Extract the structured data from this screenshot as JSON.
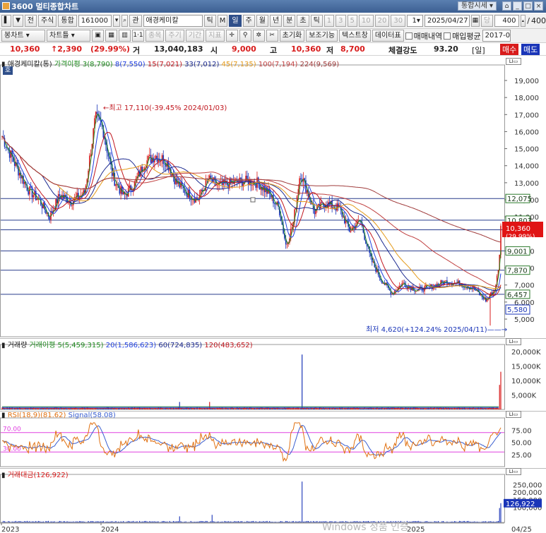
{
  "window": {
    "title": "3600 멀티종합차트",
    "sise_combo": "통합시세"
  },
  "toolbar1": {
    "market": "전",
    "type": "주식",
    "mode": "통합",
    "code": "161000",
    "name_btn": "관",
    "stock_name": "애경케미칼",
    "periods": [
      "틱",
      "일",
      "주",
      "월",
      "년",
      "분",
      "초",
      "틱"
    ],
    "numbers": [
      "1",
      "3",
      "5",
      "10",
      "20",
      "30"
    ],
    "count_select": "1",
    "date": "2025/04/27",
    "dang": "당",
    "count": "400",
    "total": "400"
  },
  "toolbar2": {
    "chart_type": "봉차트",
    "chart_frame": "차트틀",
    "items": [
      "종목",
      "주기",
      "기간",
      "지표"
    ],
    "btns": [
      "초기화",
      "보조기능",
      "텍스트창",
      "데이터표"
    ],
    "checks": [
      "매매내역",
      "매입평균"
    ],
    "date_right": "2017-01"
  },
  "price_row": {
    "price": "10,360",
    "change": "↑2,390",
    "rate": "(29.99%)",
    "vol_label": "거",
    "volume": "13,040,183",
    "open_label": "시",
    "open": "9,000",
    "high_label": "고",
    "high": "10,360",
    "low_label": "저",
    "low": "8,700",
    "strength_label": "체결강도",
    "strength": "93.20",
    "period_tag": "[일]",
    "buy": "매수",
    "sell": "매도"
  },
  "colors": {
    "up": "#d81b1b",
    "down": "#1a35b8",
    "ma3": "#1f8a1f",
    "ma8": "#2040e0",
    "ma15": "#c0161e",
    "ma33": "#1c2a90",
    "ma45": "#e49a1a",
    "ma100": "#c04040",
    "ma224": "#a03c3c",
    "rsi": "#e07010",
    "signal": "#3a5fd0",
    "guide": "#e040e0"
  },
  "main_legend": {
    "name": "애경케미칼(통)",
    "items": [
      {
        "label": "가격이평 3(8,790)",
        "color": "ma3"
      },
      {
        "label": "8(7,550)",
        "color": "ma8"
      },
      {
        "label": "15(7,021)",
        "color": "ma15"
      },
      {
        "label": "33(7,012)",
        "color": "ma33"
      },
      {
        "label": "45(7,135)",
        "color": "ma45"
      },
      {
        "label": "100(7,194)",
        "color": "ma100"
      },
      {
        "label": "224(9,569)",
        "color": "ma224"
      }
    ],
    "corner": "호"
  },
  "annotations": {
    "high": "←최고 17,110(-39.45% 2024/01/03)",
    "low": "최저 4,620(+124.24% 2025/04/11)——→"
  },
  "price_axis": [
    "19,000",
    "18,000",
    "17,000",
    "16,000",
    "15,000",
    "14,000",
    "13,000",
    "12,000",
    "11,000",
    "10,000",
    "9,000",
    "8,000",
    "7,000",
    "6,000",
    "5,000"
  ],
  "price_lines": [
    {
      "label": "12,075",
      "color": "#1a35b8"
    },
    {
      "label": "10,803",
      "color": "#1a35b8"
    },
    {
      "label": "10,238",
      "color": "#1a35b8"
    },
    {
      "label": "9,001",
      "color": "#1a35b8"
    },
    {
      "label": "7,870",
      "color": "#1a35b8"
    },
    {
      "label": "6,457",
      "color": "#1a35b8"
    }
  ],
  "price_badges": {
    "current": "10,360",
    "current_pct": "(29.99%)",
    "low_badge": "5,580"
  },
  "volume_legend": {
    "name": "거래량",
    "items": [
      {
        "label": "거래이평 5(5,459,315)",
        "color": "ma3"
      },
      {
        "label": "20(1,586,623)",
        "color": "ma8"
      },
      {
        "label": "60(724,835)",
        "color": "ma33"
      },
      {
        "label": "120(483,652)",
        "color": "ma15"
      }
    ]
  },
  "volume_axis": [
    "20,000K",
    "15,000K",
    "10,000K",
    "5,000K"
  ],
  "rsi_legend": {
    "items": [
      {
        "label": "RSI(18,9)(81.62)",
        "color": "rsi"
      },
      {
        "label": "Signal(58.08)",
        "color": "signal"
      }
    ],
    "level_high": "70.00",
    "level_low": "30.00"
  },
  "rsi_axis": [
    "75.00",
    "50.00",
    "25.00"
  ],
  "amount_legend": {
    "name": "거래대금(126,922)"
  },
  "amount_axis": [
    "250,000",
    "200,000",
    "150,000",
    "100,000"
  ],
  "amount_badge": "126,922",
  "x_axis": [
    "2023",
    "2024",
    "2025",
    "04/25"
  ],
  "watermark": "Windows 정품 인증"
}
